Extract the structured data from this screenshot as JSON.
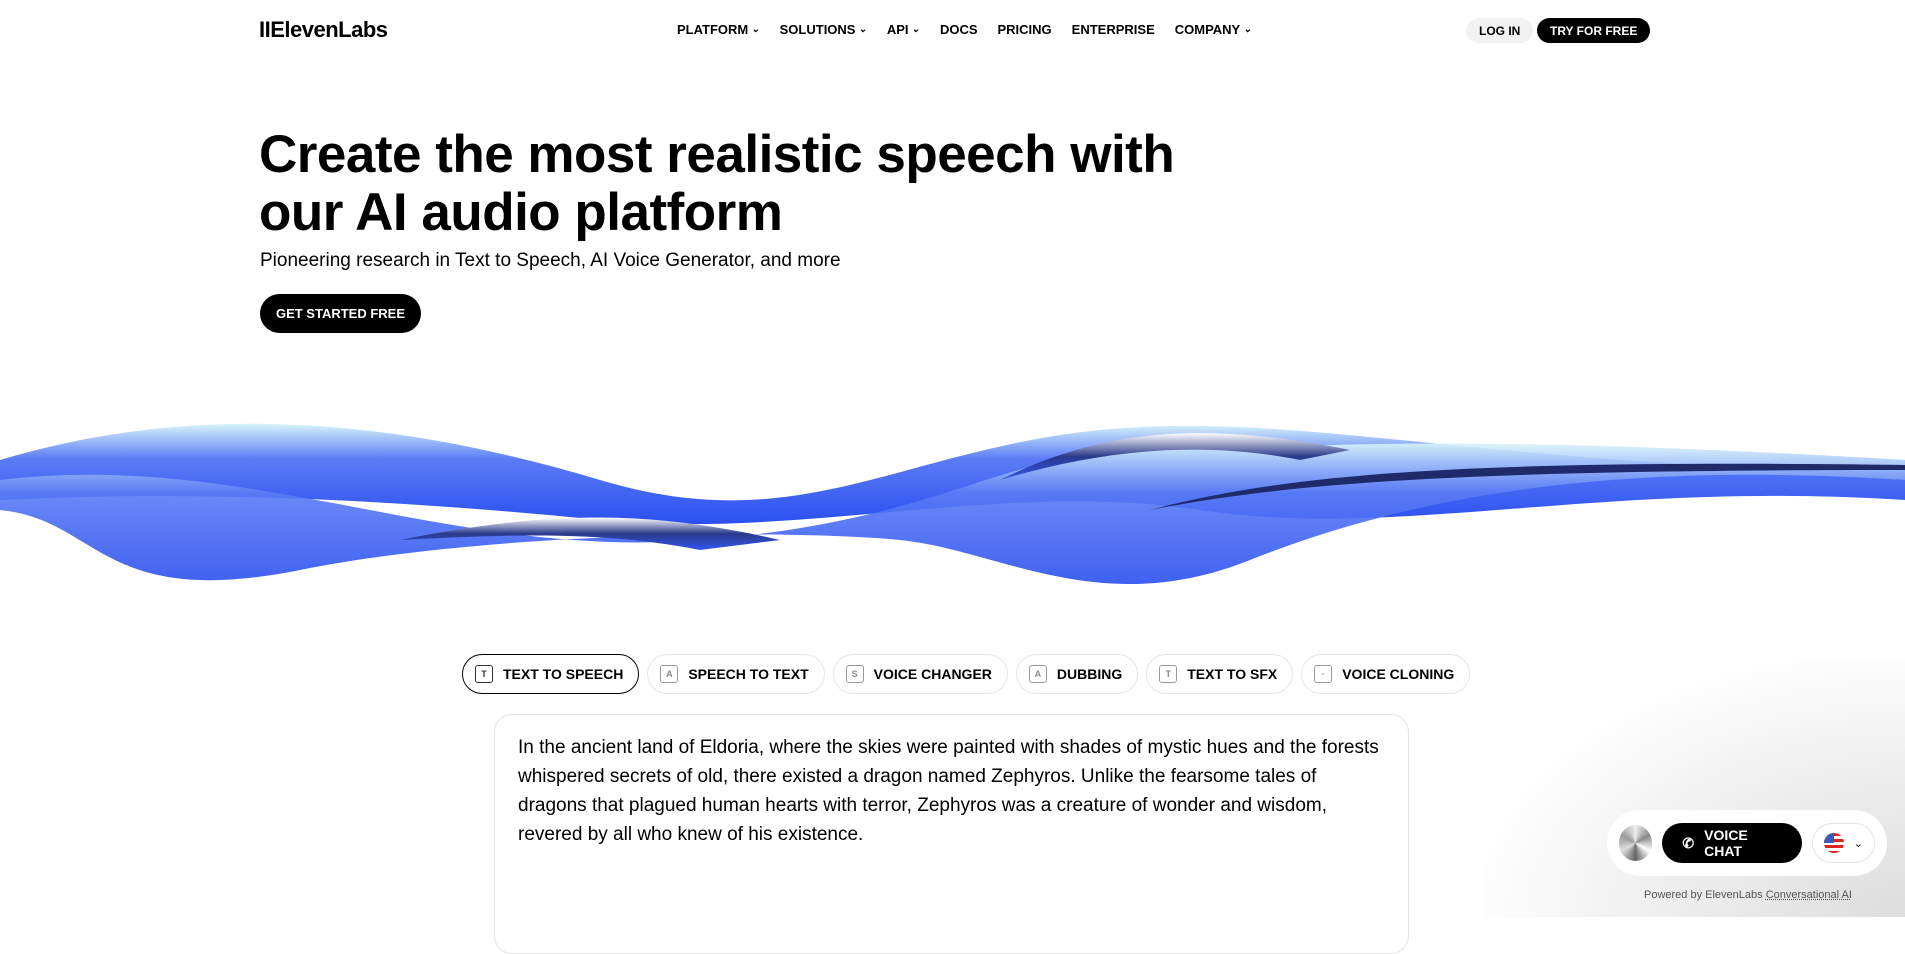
{
  "nav": {
    "logo": "IIElevenLabs",
    "links": [
      {
        "label": "PLATFORM",
        "chev": true
      },
      {
        "label": "SOLUTIONS",
        "chev": true
      },
      {
        "label": "API",
        "chev": true
      },
      {
        "label": "DOCS"
      },
      {
        "label": "PRICING"
      },
      {
        "label": "ENTERPRISE"
      },
      {
        "label": "COMPANY",
        "chev": true
      }
    ],
    "login": "LOG IN",
    "try": "TRY FOR FREE"
  },
  "hero": {
    "title": "Create the most realistic speech with our AI audio platform",
    "subtitle": "Pioneering research in Text to Speech, AI Voice Generator, and more",
    "cta": "GET STARTED FREE"
  },
  "tabs": [
    {
      "label": "TEXT TO SPEECH",
      "icon": "T",
      "active": true
    },
    {
      "label": "SPEECH TO TEXT",
      "icon": "A"
    },
    {
      "label": "VOICE CHANGER",
      "icon": "S"
    },
    {
      "label": "DUBBING",
      "icon": "A"
    },
    {
      "label": "TEXT TO SFX",
      "icon": "T"
    },
    {
      "label": "VOICE CLONING",
      "icon": "·"
    }
  ],
  "editor": {
    "text": "In the ancient land of Eldoria, where the skies were painted with shades of mystic hues and the forests whispered secrets of old, there existed a dragon named Zephyros. Unlike the fearsome tales of dragons that plagued human hearts with terror, Zephyros was a creature of wonder and wisdom, revered by all who knew of his existence."
  },
  "widget": {
    "voice_chat": "VOICE CHAT",
    "powered_prefix": "Powered by ElevenLabs ",
    "powered_link": "Conversational AI"
  }
}
